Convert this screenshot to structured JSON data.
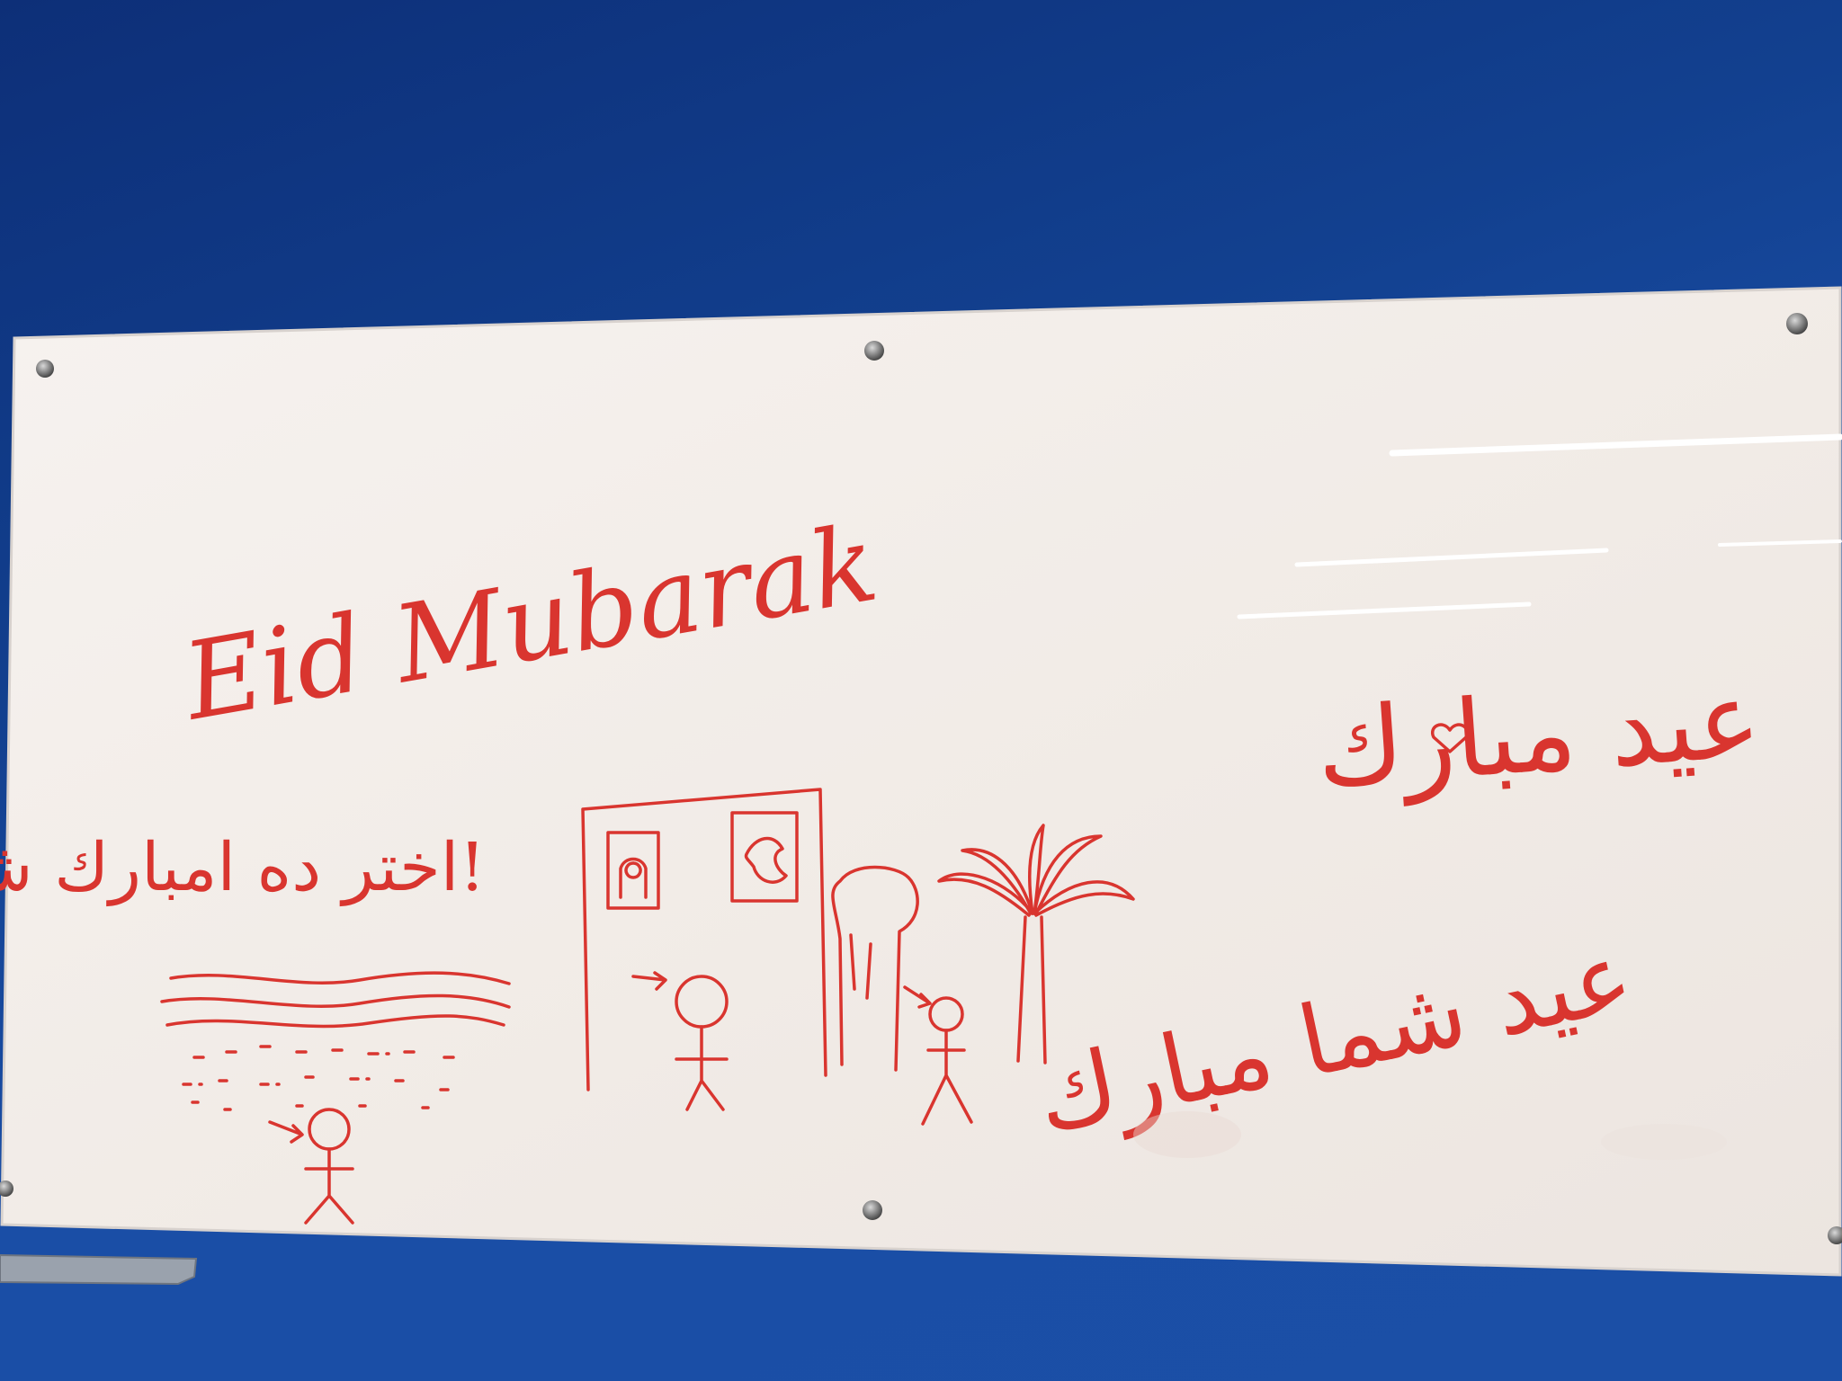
{
  "whiteboard": {
    "english_greeting": "Eid Mubarak",
    "arabic_greeting_top": "عيد مبارك",
    "arabic_greeting_middle": "عيد شما مبارك",
    "persian_message": "اختر ده امبارك شد!"
  },
  "colors": {
    "wall": "#1a4ea6",
    "board": "#f4efeb",
    "marker": "#d9352f",
    "pin": "#6f6f6f"
  },
  "icons": [
    "stick-figure-icon",
    "palm-tree-icon",
    "tree-icon",
    "house-icon",
    "wave-lines-icon",
    "arrow-icon",
    "heart-icon"
  ]
}
